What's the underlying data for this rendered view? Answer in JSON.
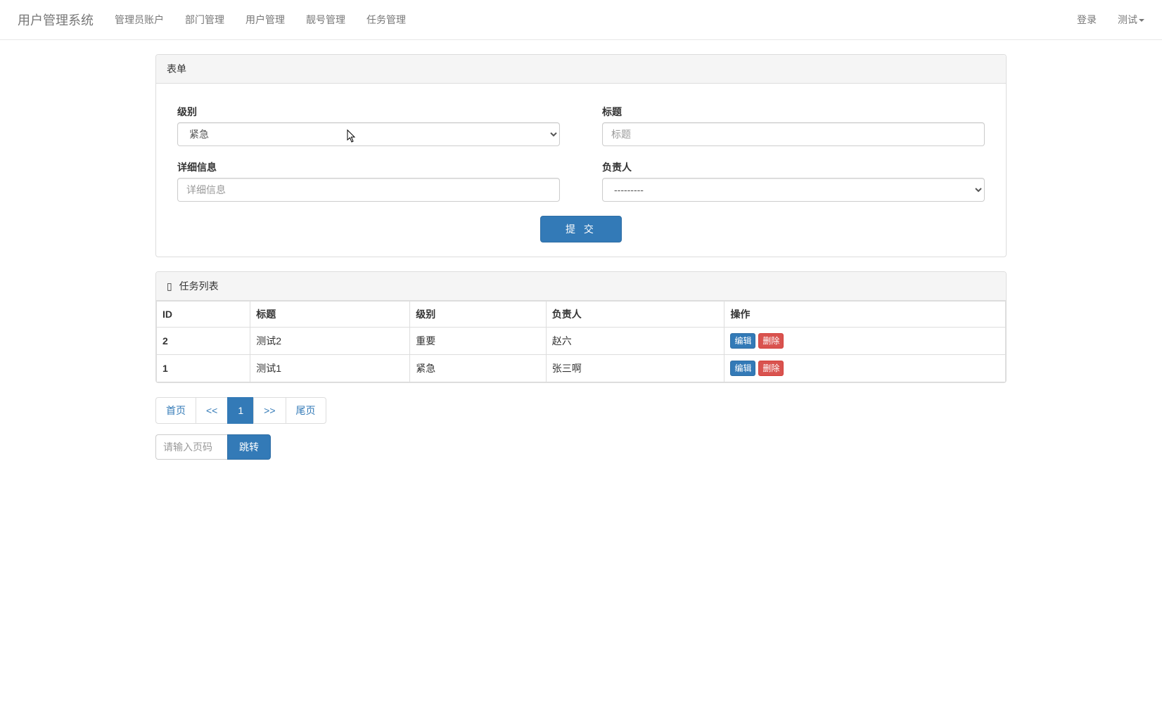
{
  "navbar": {
    "brand": "用户管理系统",
    "items": [
      "管理员账户",
      "部门管理",
      "用户管理",
      "靓号管理",
      "任务管理"
    ],
    "right_login": "登录",
    "right_dropdown": "测试"
  },
  "form_panel": {
    "title": "表单",
    "level_label": "级别",
    "level_selected": "紧急",
    "title_label": "标题",
    "title_placeholder": "标题",
    "detail_label": "详细信息",
    "detail_placeholder": "详细信息",
    "owner_label": "负责人",
    "owner_selected": "---------",
    "submit_label": "提 交"
  },
  "list_panel": {
    "title": "任务列表",
    "columns": [
      "ID",
      "标题",
      "级别",
      "负责人",
      "操作"
    ],
    "rows": [
      {
        "id": "2",
        "title": "测试2",
        "level": "重要",
        "owner": "赵六"
      },
      {
        "id": "1",
        "title": "测试1",
        "level": "紧急",
        "owner": "张三啊"
      }
    ],
    "edit_label": "编辑",
    "delete_label": "删除"
  },
  "pagination": {
    "first": "首页",
    "prev": "<<",
    "current": "1",
    "next": ">>",
    "last": "尾页",
    "jump_placeholder": "请输入页码",
    "jump_label": "跳转"
  }
}
